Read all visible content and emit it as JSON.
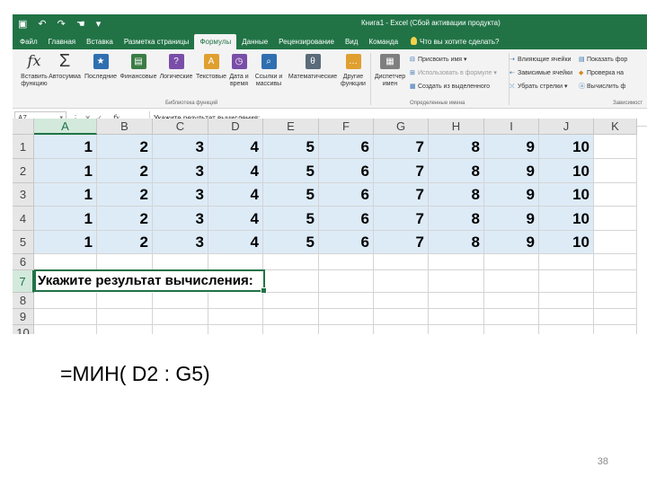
{
  "titlebar": {
    "doc_title": "Книга1 - Excel (Сбой активации продукта)",
    "qat_icons": [
      "save-icon",
      "undo-icon",
      "redo-icon",
      "touch-mode-icon",
      "customize-icon"
    ]
  },
  "tabs": [
    {
      "label": "Файл",
      "active": false
    },
    {
      "label": "Главная",
      "active": false
    },
    {
      "label": "Вставка",
      "active": false
    },
    {
      "label": "Разметка страницы",
      "active": false
    },
    {
      "label": "Формулы",
      "active": true
    },
    {
      "label": "Данные",
      "active": false
    },
    {
      "label": "Рецензирование",
      "active": false
    },
    {
      "label": "Вид",
      "active": false
    },
    {
      "label": "Команда",
      "active": false
    }
  ],
  "tell_me": "Что вы хотите сделать?",
  "ribbon": {
    "function_library": {
      "buttons": [
        {
          "label": "Вставить функцию",
          "icon": "fx-icon",
          "glyph": "fx"
        },
        {
          "label": "Автосумма",
          "icon": "sigma-icon",
          "glyph": "Σ"
        },
        {
          "label": "Последние",
          "icon": "star-icon",
          "glyph": "★",
          "color": "#2f6fb0"
        },
        {
          "label": "Финансовые",
          "icon": "book-icon",
          "glyph": "▤",
          "color": "#3a7d44"
        },
        {
          "label": "Логические",
          "icon": "question-icon",
          "glyph": "?",
          "color": "#7a4ea8"
        },
        {
          "label": "Текстовые",
          "icon": "text-icon",
          "glyph": "A",
          "color": "#e0a030"
        },
        {
          "label": "Дата и время",
          "icon": "clock-icon",
          "glyph": "◷",
          "color": "#7a4ea8"
        },
        {
          "label": "Ссылки и массивы",
          "icon": "lookup-icon",
          "glyph": "⌕",
          "color": "#2f6fb0"
        },
        {
          "label": "Математические",
          "icon": "theta-icon",
          "glyph": "θ",
          "color": "#5a6b7a"
        },
        {
          "label": "Другие функции",
          "icon": "more-icon",
          "glyph": "…",
          "color": "#e0a030"
        }
      ],
      "group_label": "Библиотека функций"
    },
    "defined_names": {
      "manager": {
        "label": "Диспетчер имен",
        "icon": "name-manager-icon"
      },
      "items": [
        "Присвоить имя",
        "Использовать в формуле",
        "Создать из выделенного"
      ],
      "group_label": "Определенные имена"
    },
    "formula_auditing": {
      "items": [
        "Влияющие ячейки",
        "Зависимые ячейки",
        "Убрать стрелки",
        "Показать фор",
        "Проверка на",
        "Вычислить ф"
      ],
      "group_label": "Зависимост"
    }
  },
  "formula_bar": {
    "name_box": "A7",
    "content": "Укажите результат вычисления:"
  },
  "grid": {
    "columns": [
      "A",
      "B",
      "C",
      "D",
      "E",
      "F",
      "G",
      "H",
      "I",
      "J",
      "K"
    ],
    "rows": [
      "1",
      "2",
      "3",
      "4",
      "5",
      "6",
      "7",
      "8",
      "9",
      "10"
    ],
    "data": [
      [
        "1",
        "2",
        "3",
        "4",
        "5",
        "6",
        "7",
        "8",
        "9",
        "10"
      ],
      [
        "1",
        "2",
        "3",
        "4",
        "5",
        "6",
        "7",
        "8",
        "9",
        "10"
      ],
      [
        "1",
        "2",
        "3",
        "4",
        "5",
        "6",
        "7",
        "8",
        "9",
        "10"
      ],
      [
        "1",
        "2",
        "3",
        "4",
        "5",
        "6",
        "7",
        "8",
        "9",
        "10"
      ],
      [
        "1",
        "2",
        "3",
        "4",
        "5",
        "6",
        "7",
        "8",
        "9",
        "10"
      ]
    ],
    "task_text": "Укажите результат вычисления:",
    "active_column": "A",
    "active_row": "7",
    "fill_color": "#ddebf7",
    "accent_color": "#217346"
  },
  "slide": {
    "formula": "=МИН( D2 : G5)",
    "page_number": "38"
  }
}
